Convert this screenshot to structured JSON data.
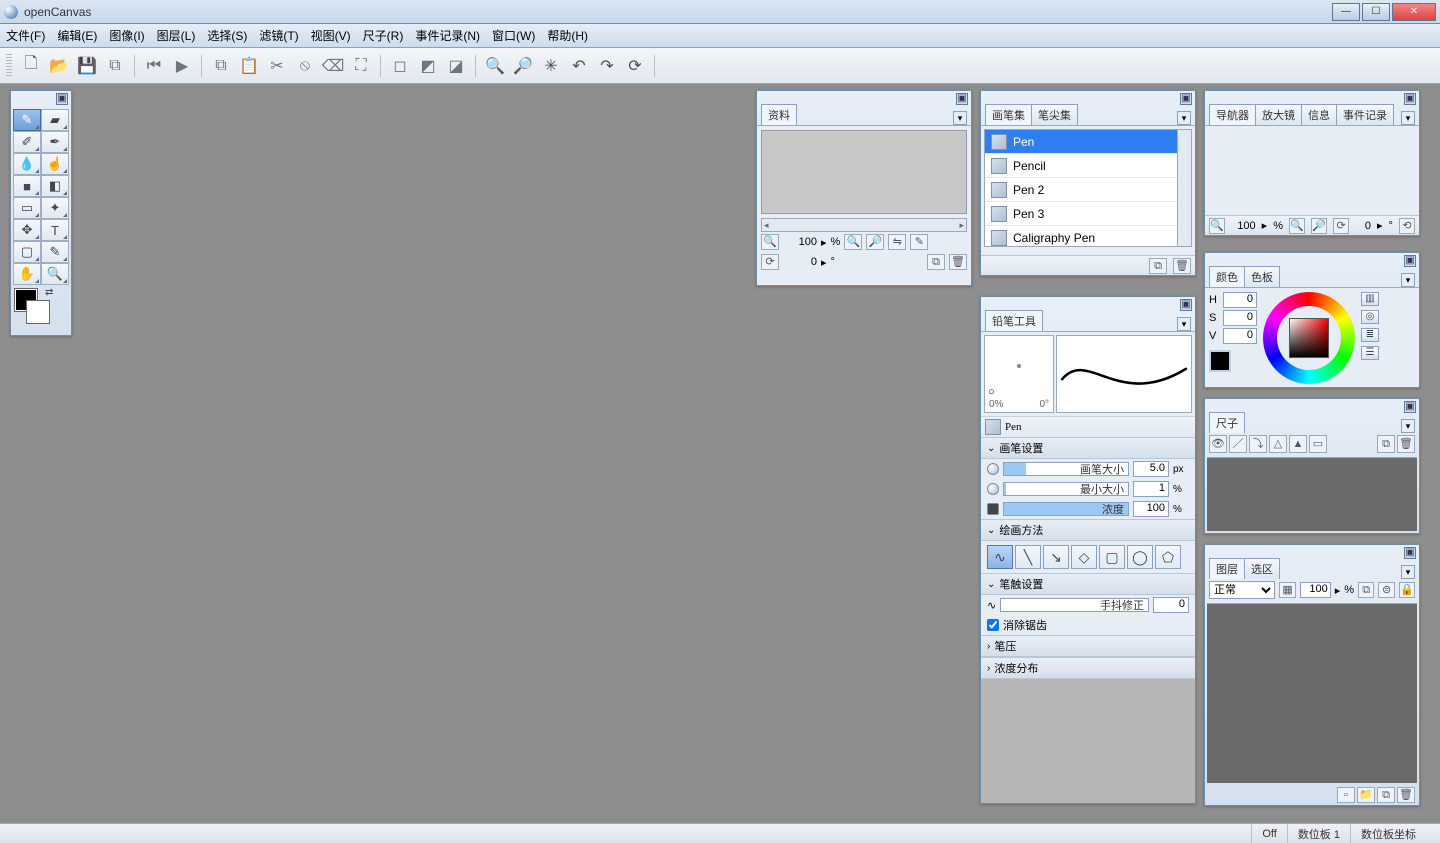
{
  "app_title": "openCanvas",
  "menu": [
    "文件(F)",
    "编辑(E)",
    "图像(I)",
    "图层(L)",
    "选择(S)",
    "滤镜(T)",
    "视图(V)",
    "尺子(R)",
    "事件记录(N)",
    "窗口(W)",
    "帮助(H)"
  ],
  "toolbar_groups": [
    [
      "new-file",
      "open-file",
      "save-file",
      "save-copy"
    ],
    [
      "seek-start",
      "play"
    ],
    [
      "copy",
      "paste",
      "cut",
      "clear",
      "eraser-all",
      "transform"
    ],
    [
      "deselect",
      "reselect",
      "invert-sel"
    ],
    [
      "zoom-in",
      "zoom-out",
      "fit",
      "undo",
      "redo",
      "rotate-reset"
    ]
  ],
  "tools": [
    [
      "pen",
      "eraser"
    ],
    [
      "pencil",
      "airbrush"
    ],
    [
      "blur",
      "finger"
    ],
    [
      "fill",
      "gradient"
    ],
    [
      "rect-select",
      "wand"
    ],
    [
      "move",
      "text"
    ],
    [
      "crop",
      "eyedropper"
    ],
    [
      "hand",
      "zoom"
    ]
  ],
  "tool_selected": "pen",
  "swatch": {
    "fg": "#000000",
    "bg": "#ffffff"
  },
  "material": {
    "tab": "资料",
    "zoom": "100",
    "zoom_unit": "%",
    "angle": "0",
    "angle_unit": "°"
  },
  "brushset": {
    "tabs": [
      "画笔集",
      "笔尖集"
    ],
    "active_tab": 0,
    "items": [
      "Pen",
      "Pencil",
      "Pen 2",
      "Pen 3",
      "Caligraphy Pen"
    ],
    "selected": 0
  },
  "navigator": {
    "tabs": [
      "导航器",
      "放大镜",
      "信息",
      "事件记录"
    ],
    "active_tab": 0,
    "zoom": "100",
    "zoom_unit": "%",
    "angle": "0",
    "angle_unit": "°"
  },
  "color": {
    "tabs": [
      "颜色",
      "色板"
    ],
    "active_tab": 0,
    "H": "0",
    "S": "0",
    "V": "0",
    "current": "#000000"
  },
  "ruler": {
    "tab": "尺子"
  },
  "layer": {
    "tabs": [
      "图层",
      "选区"
    ],
    "active_tab": 0,
    "blend_mode": "正常",
    "opacity": "100",
    "opacity_unit": "%"
  },
  "pencil_tool": {
    "tab": "铅笔工具",
    "preview_left": "0%",
    "preview_right": "0°",
    "current_name": "Pen",
    "sections": {
      "brush_settings": "画笔设置",
      "draw_method": "绘画方法",
      "stroke_settings": "笔触设置",
      "pressure": "笔压",
      "density_dist": "浓度分布"
    },
    "params": {
      "size_label": "画笔大小",
      "size_val": "5.0",
      "size_unit": "px",
      "size_pct": 18,
      "minsize_label": "最小大小",
      "minsize_val": "1",
      "minsize_unit": "%",
      "minsize_pct": 2,
      "density_label": "浓度",
      "density_val": "100",
      "density_unit": "%",
      "density_pct": 100,
      "jitter_label": "手抖修正",
      "jitter_val": "0",
      "antialias_label": "消除锯齿",
      "antialias_checked": true
    }
  },
  "status": {
    "off": "Off",
    "tablet": "数位板 1",
    "tablet_coord": "数位板坐标"
  }
}
